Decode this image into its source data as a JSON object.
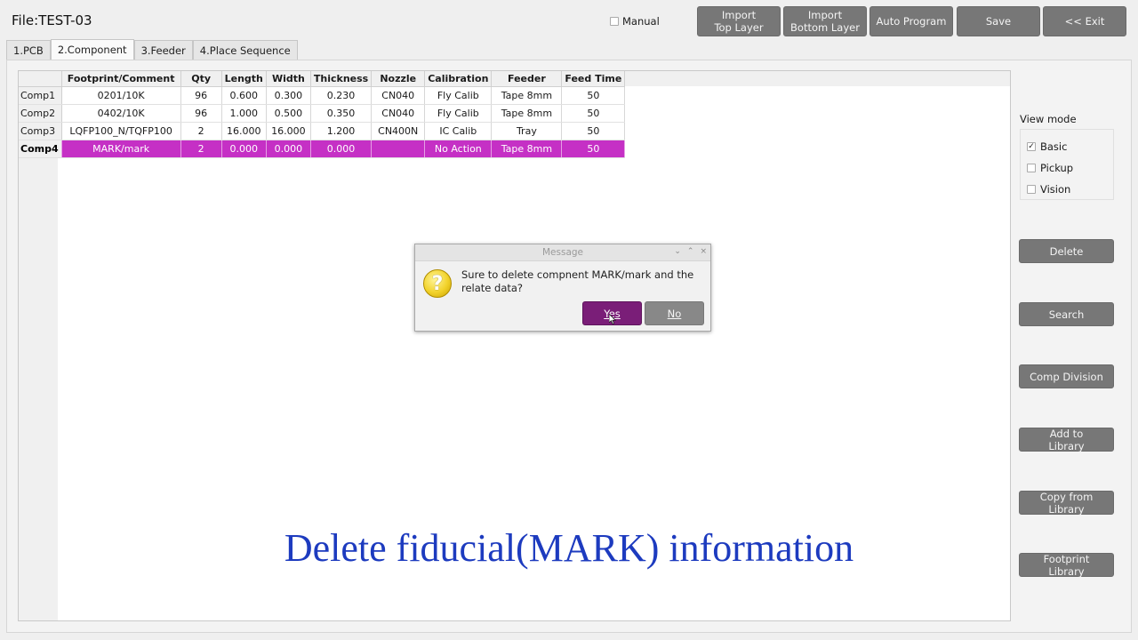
{
  "file_title": "File:TEST-03",
  "manual": {
    "label": "Manual",
    "checked": false
  },
  "top_buttons": [
    {
      "line1": "Import",
      "line2": "Top Layer"
    },
    {
      "line1": "Import",
      "line2": "Bottom Layer"
    },
    {
      "line1": "Auto Program",
      "line2": ""
    },
    {
      "line1": "Save",
      "line2": ""
    },
    {
      "line1": "<< Exit",
      "line2": ""
    }
  ],
  "tabs": [
    "1.PCB",
    "2.Component",
    "3.Feeder",
    "4.Place Sequence"
  ],
  "active_tab": "2.Component",
  "table": {
    "columns": [
      "Footprint/Comment",
      "Qty",
      "Length",
      "Width",
      "Thickness",
      "Nozzle",
      "Calibration",
      "Feeder",
      "Feed Time"
    ],
    "rows": [
      {
        "id": "Comp1",
        "cells": [
          "0201/10K",
          "96",
          "0.600",
          "0.300",
          "0.230",
          "CN040",
          "Fly Calib",
          "Tape 8mm",
          "50"
        ]
      },
      {
        "id": "Comp2",
        "cells": [
          "0402/10K",
          "96",
          "1.000",
          "0.500",
          "0.350",
          "CN040",
          "Fly Calib",
          "Tape 8mm",
          "50"
        ]
      },
      {
        "id": "Comp3",
        "cells": [
          "LQFP100_N/TQFP100",
          "2",
          "16.000",
          "16.000",
          "1.200",
          "CN400N",
          "IC Calib",
          "Tray",
          "50"
        ]
      },
      {
        "id": "Comp4",
        "cells": [
          "MARK/mark",
          "2",
          "0.000",
          "0.000",
          "0.000",
          "",
          "No Action",
          "Tape 8mm",
          "50"
        ]
      }
    ],
    "selected_row": "Comp4"
  },
  "view_mode": {
    "label": "View mode",
    "options": [
      {
        "label": "Basic",
        "checked": true
      },
      {
        "label": "Pickup",
        "checked": false
      },
      {
        "label": "Vision",
        "checked": false
      }
    ]
  },
  "side_buttons": [
    {
      "line1": "Delete",
      "line2": ""
    },
    {
      "line1": "Search",
      "line2": ""
    },
    {
      "line1": "Comp Division",
      "line2": ""
    },
    {
      "line1": "Add to",
      "line2": "Library"
    },
    {
      "line1": "Copy from",
      "line2": "Library"
    },
    {
      "line1": "Footprint",
      "line2": "Library"
    }
  ],
  "dialog": {
    "title": "Message",
    "message": "Sure to delete compnent MARK/mark and the relate data?",
    "icon": "question-icon",
    "icon_glyph": "?",
    "yes_label": "Yes",
    "no_label": "No",
    "controls": [
      "⌄",
      "⌃",
      "×"
    ]
  },
  "caption": "Delete fiducial(MARK) information",
  "colors": {
    "selected_row": "#c530c5",
    "button_gray": "#777777",
    "yes_button": "#7a1e78",
    "caption": "#1d3bbf"
  }
}
